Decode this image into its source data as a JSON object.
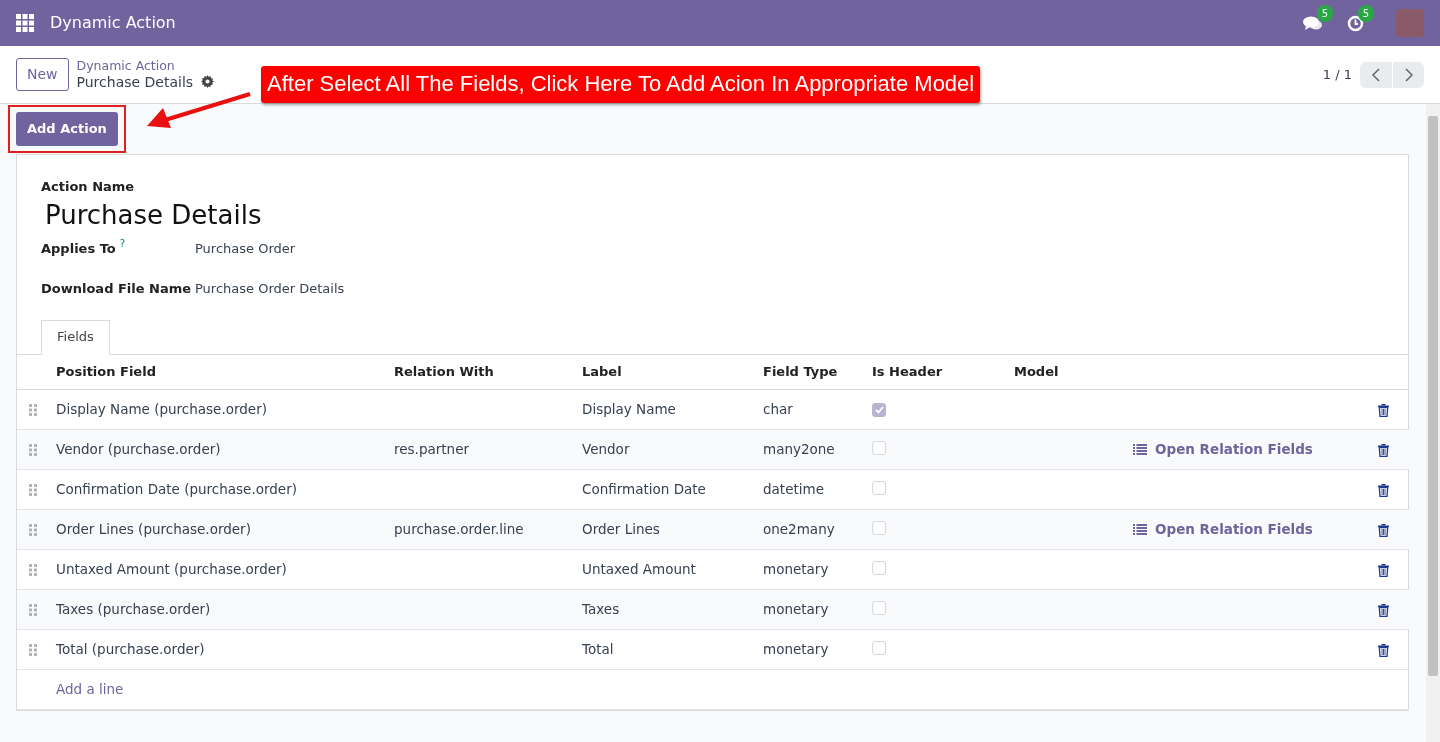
{
  "navbar": {
    "app_title": "Dynamic Action",
    "messages_count": "5",
    "activities_count": "5"
  },
  "control_panel": {
    "new_button": "New",
    "breadcrumb_parent": "Dynamic Action",
    "breadcrumb_current": "Purchase Details",
    "pager": "1 / 1"
  },
  "annotation": {
    "text": "After Select All The Fields, Click Here To Add Acion In Appropriate Model"
  },
  "toolbar": {
    "buttons": [
      "Add Action"
    ]
  },
  "form": {
    "action_name_label": "Action Name",
    "action_name": "Purchase Details",
    "fields": [
      {
        "label": "Applies To",
        "help": "?",
        "value": "Purchase Order"
      },
      {
        "label": "Download File Name",
        "value": "Purchase Order Details"
      }
    ],
    "tabs": [
      {
        "label": "Fields",
        "selected": true
      }
    ],
    "table": {
      "columns": [
        "Position Field",
        "Relation With",
        "Label",
        "Field Type",
        "Is Header",
        "Model"
      ],
      "rows": [
        {
          "position_field": "Display Name (purchase.order)",
          "relation_with": "",
          "label": "Display Name",
          "field_type": "char",
          "is_header": true
        },
        {
          "position_field": "Vendor (purchase.order)",
          "relation_with": "res.partner",
          "label": "Vendor",
          "field_type": "many2one",
          "is_header": false,
          "action": "Open Relation Fields"
        },
        {
          "position_field": "Confirmation Date (purchase.order)",
          "relation_with": "",
          "label": "Confirmation Date",
          "field_type": "datetime",
          "is_header": false
        },
        {
          "position_field": "Order Lines (purchase.order)",
          "relation_with": "purchase.order.line",
          "label": "Order Lines",
          "field_type": "one2many",
          "is_header": false,
          "action": "Open Relation Fields"
        },
        {
          "position_field": "Untaxed Amount (purchase.order)",
          "relation_with": "",
          "label": "Untaxed Amount",
          "field_type": "monetary",
          "is_header": false
        },
        {
          "position_field": "Taxes (purchase.order)",
          "relation_with": "",
          "label": "Taxes",
          "field_type": "monetary",
          "is_header": false
        },
        {
          "position_field": "Total (purchase.order)",
          "relation_with": "",
          "label": "Total",
          "field_type": "monetary",
          "is_header": false
        }
      ],
      "add_line": "Add a line"
    }
  }
}
